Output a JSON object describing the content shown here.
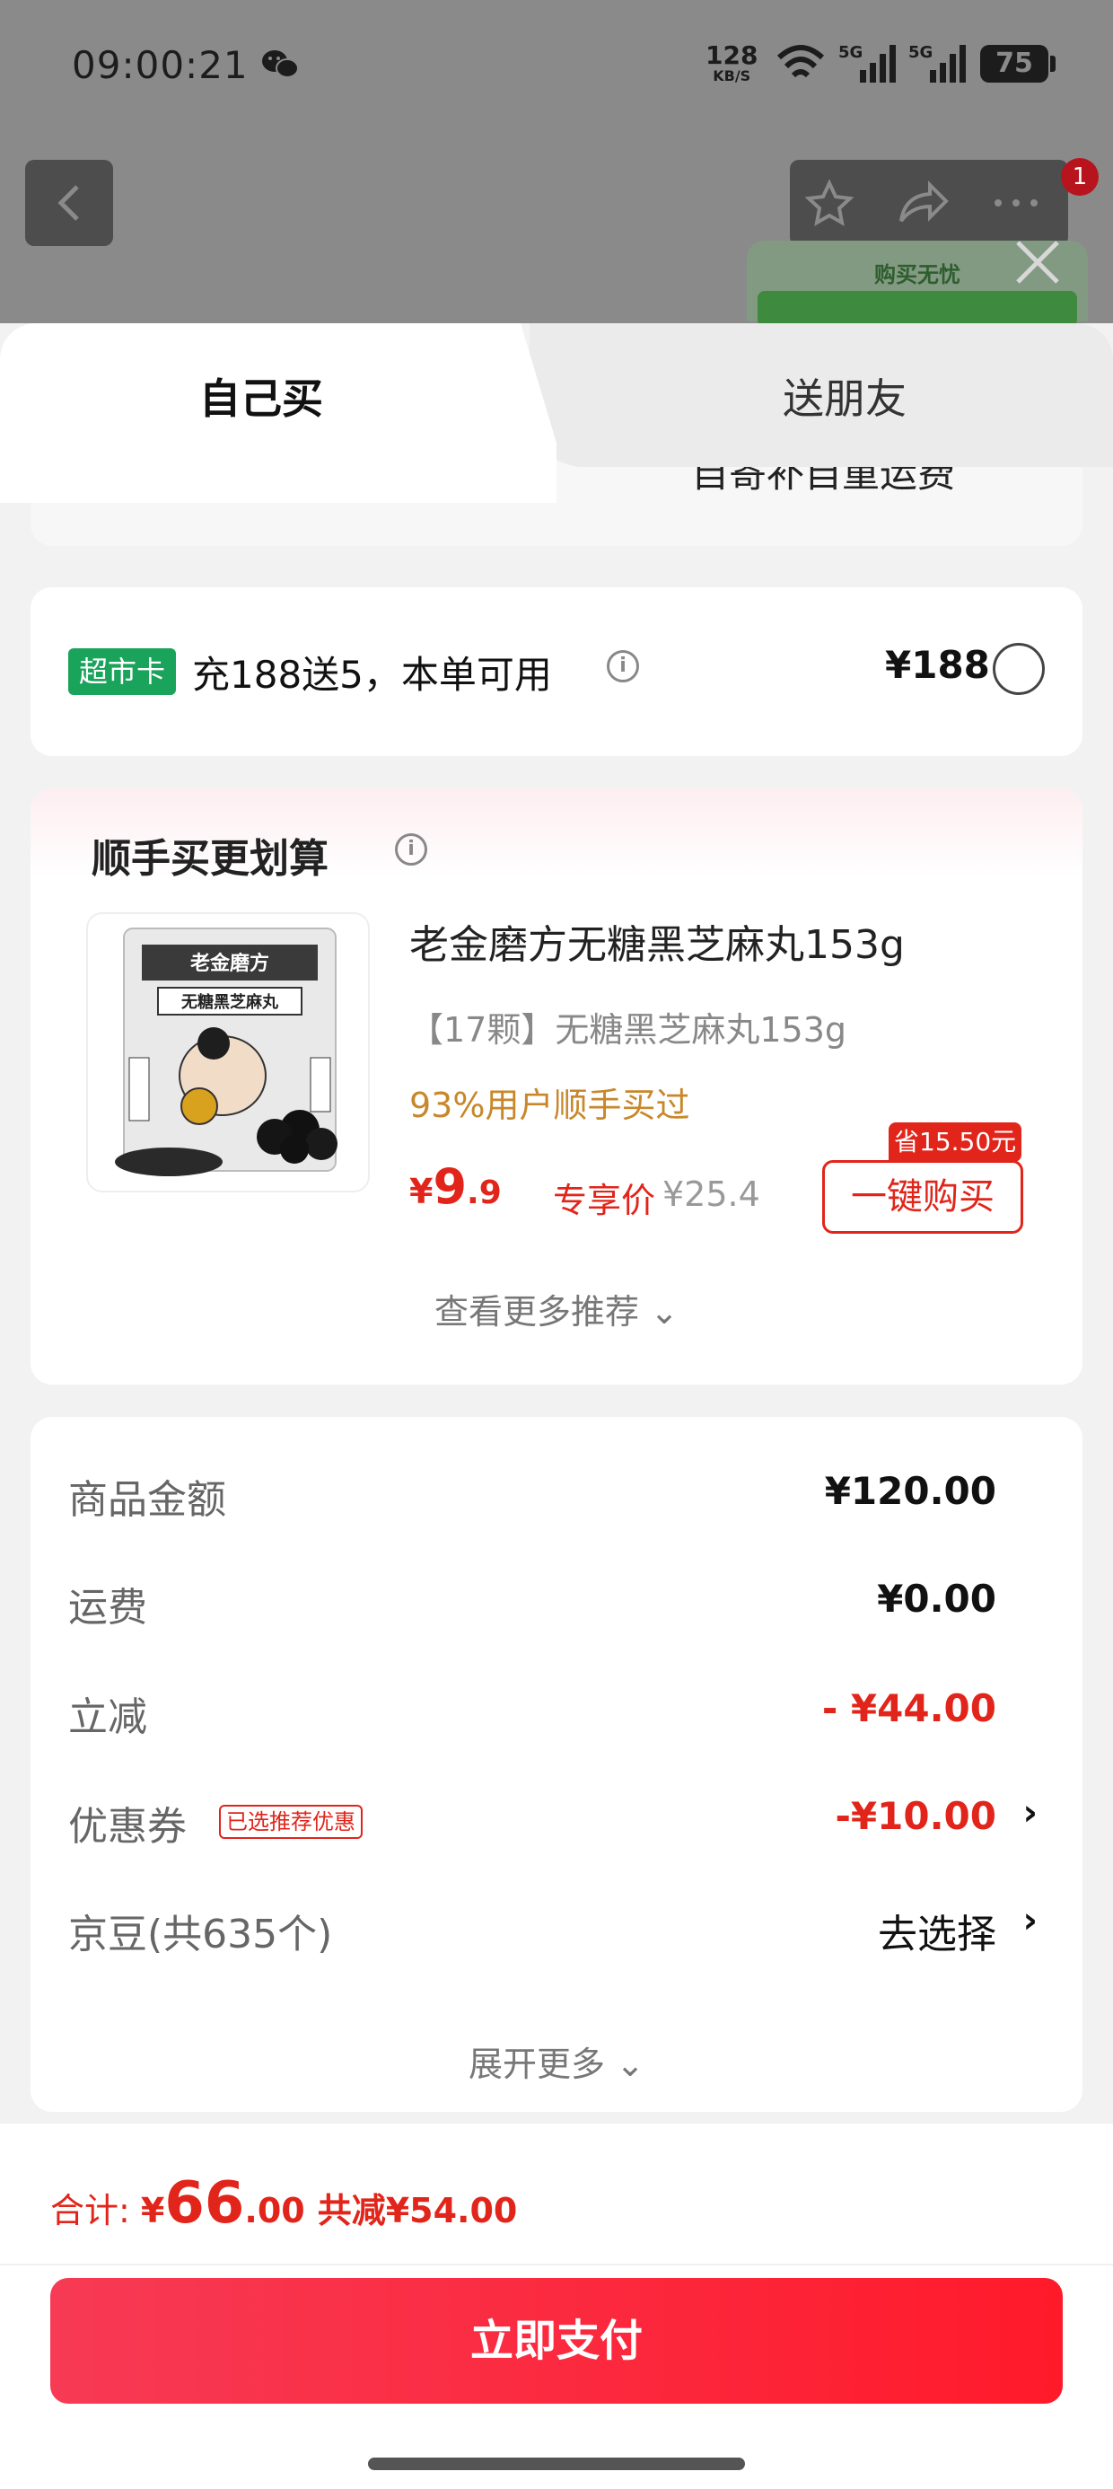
{
  "status_bar": {
    "time": "09:00:21",
    "net_speed_value": "128",
    "net_speed_unit": "KB/S",
    "battery": "75",
    "network_labels": [
      "5G",
      "5G"
    ]
  },
  "badge_count": "1",
  "worry_free": "购买无忧",
  "tabs": {
    "self": "自己买",
    "friend": "送朋友"
  },
  "partial_text": "自寄补自重运费",
  "supermarket": {
    "chip": "超市卡",
    "text": "充188送5，本单可用",
    "price": "¥188"
  },
  "recommend": {
    "title": "顺手买更划算",
    "product": {
      "name": "老金磨方无糖黑芝麻丸153g",
      "spec": "【17颗】无糖黑芝麻丸153g",
      "tip": "93%用户顺手买过",
      "price_currency": "¥",
      "price_int": "9",
      "price_dec": ".9",
      "exclusive": "专享价",
      "original": "¥25.4",
      "save_tag": "省15.50元",
      "buy_label": "一键购买",
      "image_brand": "老金磨方",
      "image_name": "无糖黑芝麻丸"
    },
    "more": "查看更多推荐 ⌄"
  },
  "summary": {
    "goods_label": "商品金额",
    "goods_value": "¥120.00",
    "shipping_label": "运费",
    "shipping_value": "¥0.00",
    "discount_label": "立减",
    "discount_value": "- ¥44.00",
    "coupon_label": "优惠券",
    "coupon_tag": "已选推荐优惠",
    "coupon_value": "-¥10.00",
    "beans_label": "京豆(共635个)",
    "beans_value": "去选择",
    "expand": "展开更多 ⌄"
  },
  "footer": {
    "total_label": "合计: ",
    "total_currency": "¥",
    "total_int": "66",
    "total_dec": ".00",
    "saved": "共减¥54.00",
    "pay_label": "立即支付"
  },
  "colors": {
    "accent_red": "#e1251b",
    "green_chip": "#1aa35a",
    "pay_gradient_start": "#f73a55",
    "pay_gradient_end": "#ff1a2a"
  }
}
